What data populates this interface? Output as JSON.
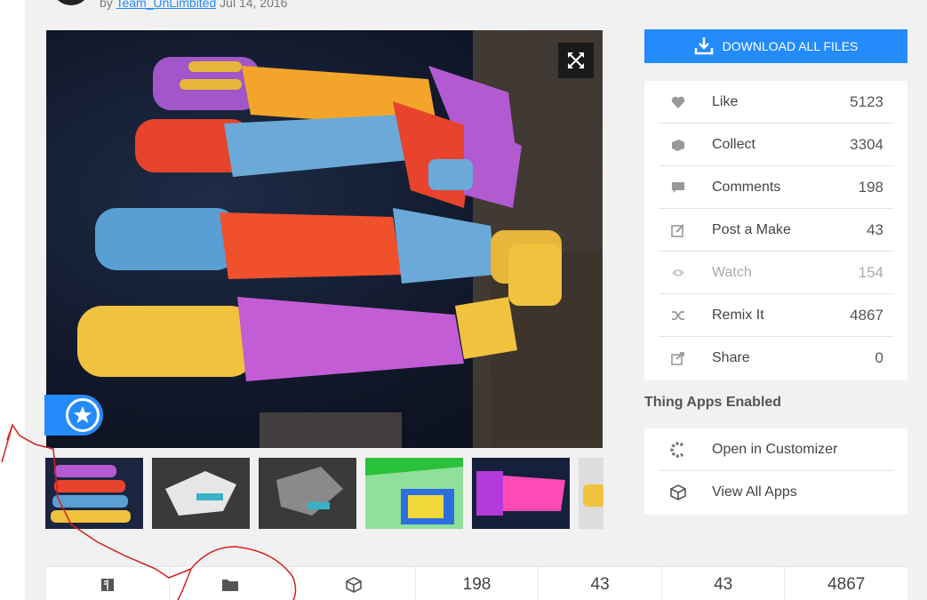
{
  "header": {
    "by_prefix": "by",
    "author": "Team_UnLimbited",
    "date": "Jul 14, 2016"
  },
  "sidebar": {
    "download_label": "DOWNLOAD ALL FILES",
    "stats": [
      {
        "label": "Like",
        "count": "5123",
        "icon": "heart-icon"
      },
      {
        "label": "Collect",
        "count": "3304",
        "icon": "collect-icon"
      },
      {
        "label": "Comments",
        "count": "198",
        "icon": "comment-icon"
      },
      {
        "label": "Post a Make",
        "count": "43",
        "icon": "edit-icon"
      },
      {
        "label": "Watch",
        "count": "154",
        "icon": "eye-icon"
      },
      {
        "label": "Remix It",
        "count": "4867",
        "icon": "shuffle-icon"
      },
      {
        "label": "Share",
        "count": "0",
        "icon": "share-icon"
      }
    ],
    "apps_title": "Thing Apps Enabled",
    "apps": [
      {
        "label": "Open in Customizer",
        "icon": "customizer-icon"
      },
      {
        "label": "View All Apps",
        "icon": "cube-icon"
      }
    ]
  },
  "tabs": [
    {
      "icon": "book-icon",
      "value": ""
    },
    {
      "icon": "folder-icon",
      "value": ""
    },
    {
      "icon": "cube-icon",
      "value": ""
    },
    {
      "icon": "",
      "value": "198"
    },
    {
      "icon": "",
      "value": "43"
    },
    {
      "icon": "",
      "value": "43"
    },
    {
      "icon": "",
      "value": "4867"
    }
  ],
  "colors": {
    "accent": "#248bfb",
    "annotation": "#d42020"
  }
}
